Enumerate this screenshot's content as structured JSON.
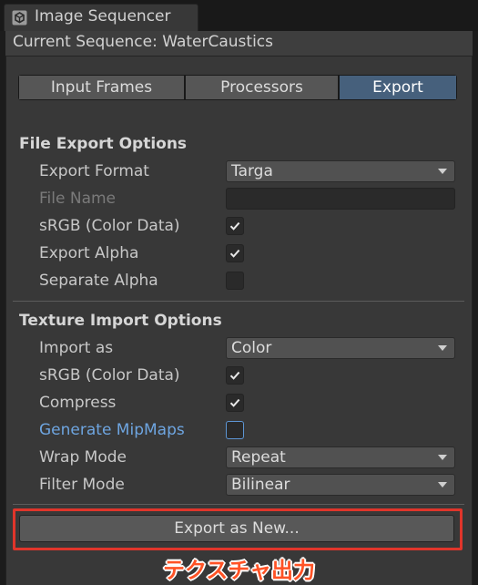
{
  "window": {
    "tab_title": "Image Sequencer",
    "tab_icon": "unity-logo-icon"
  },
  "header": {
    "current_sequence": "Current Sequence: WaterCaustics"
  },
  "tabs": [
    {
      "label": "Input Frames",
      "active": false
    },
    {
      "label": "Processors",
      "active": false
    },
    {
      "label": "Export",
      "active": true
    }
  ],
  "file_export": {
    "title": "File Export Options",
    "export_format": {
      "label": "Export Format",
      "value": "Targa"
    },
    "file_name": {
      "label": "File Name",
      "value": ""
    },
    "srgb": {
      "label": "sRGB (Color Data)",
      "checked": true
    },
    "export_alpha": {
      "label": "Export Alpha",
      "checked": true
    },
    "separate_alpha": {
      "label": "Separate Alpha",
      "checked": false
    }
  },
  "texture_import": {
    "title": "Texture Import Options",
    "import_as": {
      "label": "Import as",
      "value": "Color"
    },
    "srgb": {
      "label": "sRGB (Color Data)",
      "checked": true
    },
    "compress": {
      "label": "Compress",
      "checked": true
    },
    "generate_mipmaps": {
      "label": "Generate MipMaps",
      "checked": false
    },
    "wrap_mode": {
      "label": "Wrap Mode",
      "value": "Repeat"
    },
    "filter_mode": {
      "label": "Filter Mode",
      "value": "Bilinear"
    }
  },
  "actions": {
    "export_new": "Export as New..."
  },
  "annotation": {
    "caption": "テクスチャ出力",
    "highlight_color": "#e0352b"
  },
  "colors": {
    "accent": "#46607c",
    "link": "#6ea5e0"
  }
}
